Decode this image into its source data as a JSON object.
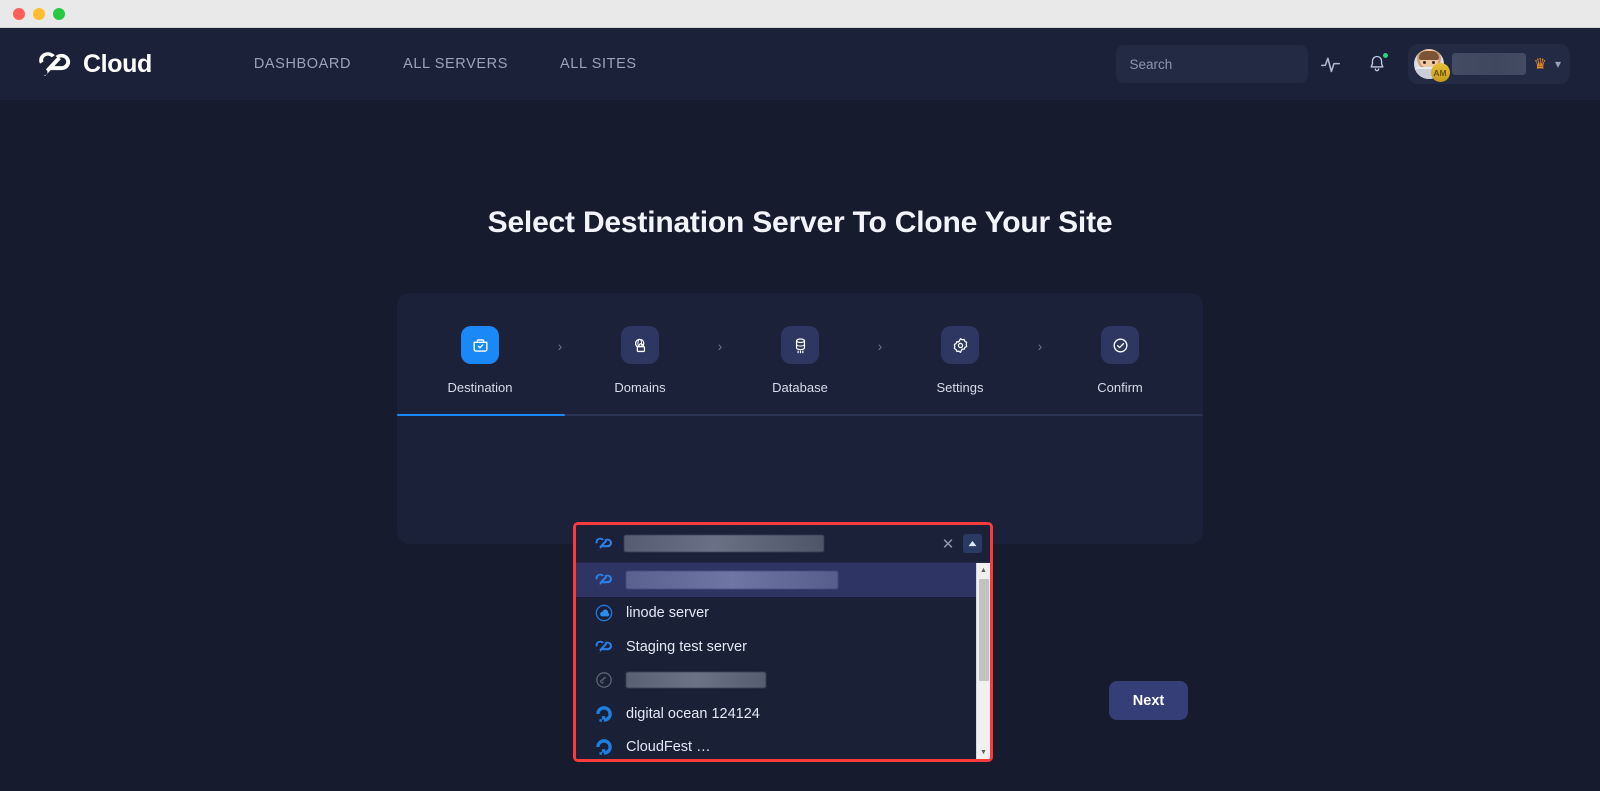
{
  "window": {
    "traffic_lights": [
      "close",
      "minimize",
      "zoom"
    ]
  },
  "navbar": {
    "brand": "Cloud",
    "brand_icon": "cloudways-rocket-logo",
    "links": [
      {
        "label": "DASHBOARD"
      },
      {
        "label": "ALL SERVERS"
      },
      {
        "label": "ALL SITES"
      }
    ],
    "search": {
      "placeholder": "Search",
      "value": "",
      "icon": "search-icon"
    },
    "activity_icon": "activity-pulse-icon",
    "notifications": {
      "icon": "bell-icon",
      "has_unread": true,
      "dot_color": "#31d07a"
    },
    "user": {
      "avatar_badge": "AM",
      "name": "",
      "name_redacted": true,
      "crown_icon": "crown-icon",
      "crown_color": "#f08a24",
      "chevron_icon": "chevron-down-icon"
    }
  },
  "main": {
    "title": "Select Destination Server To Clone Your Site",
    "steps": [
      {
        "label": "Destination",
        "icon": "folder-check-icon",
        "active": true
      },
      {
        "label": "Domains",
        "icon": "globe-lock-icon",
        "active": false
      },
      {
        "label": "Database",
        "icon": "database-icon",
        "active": false
      },
      {
        "label": "Settings",
        "icon": "gear-icon",
        "active": false
      },
      {
        "label": "Confirm",
        "icon": "check-circle-icon",
        "active": false
      }
    ],
    "step_separator": "›",
    "accent_color": "#1b88f7",
    "next_button": {
      "label": "Next"
    }
  },
  "server_dropdown": {
    "highlight_color": "#fb3b3b",
    "selected": {
      "label": "",
      "redacted": true,
      "icon": "cloudways-rocket-icon"
    },
    "clear_icon": "close-icon",
    "toggle_icon": "chevron-up-icon",
    "open": true,
    "options": [
      {
        "label": "",
        "redacted": true,
        "icon": "cloudways-rocket-icon",
        "selected": true
      },
      {
        "label": "linode server",
        "redacted": false,
        "icon": "linode-icon",
        "selected": false
      },
      {
        "label": "Staging test server",
        "redacted": false,
        "icon": "cloudways-rocket-icon",
        "selected": false
      },
      {
        "label": "",
        "redacted": true,
        "icon": "disabled-server-icon",
        "selected": false
      },
      {
        "label": "digital ocean 124124",
        "redacted": false,
        "icon": "digitalocean-icon",
        "selected": false
      },
      {
        "label": "CloudFest …",
        "redacted": false,
        "icon": "digitalocean-icon",
        "selected": false,
        "partial": true
      }
    ],
    "scrollbar": {
      "up_arrow": "▲",
      "down_arrow": "▼"
    }
  }
}
